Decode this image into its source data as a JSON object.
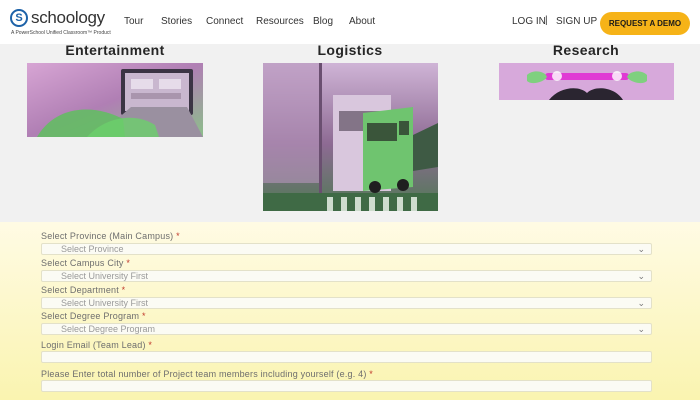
{
  "header": {
    "logo_text": "schoology",
    "logo_letter": "S",
    "logo_tagline": "A PowerSchool Unified Classroom™ Product",
    "nav": [
      "Tour",
      "Stories",
      "Connect",
      "Resources",
      "Blog",
      "About"
    ],
    "login": "LOG IN",
    "separator": "|",
    "signup": "SIGN UP",
    "demo_button": "REQUEST A DEMO"
  },
  "categories": [
    {
      "title": "Entertainment"
    },
    {
      "title": "Logistics"
    },
    {
      "title": "Research"
    }
  ],
  "form": {
    "fields": [
      {
        "label": "Select Province (Main Campus)",
        "required": "*",
        "value": "Select Province",
        "icon": "chevron-down-icon"
      },
      {
        "label": "Select Campus City",
        "required": "*",
        "value": "Select University First",
        "icon": "chevron-down-icon"
      },
      {
        "label": "Select Department",
        "required": "*",
        "value": "Select University First",
        "icon": "chevron-down-icon"
      },
      {
        "label": "Select Degree Program",
        "required": "*",
        "value": "Select Degree Program",
        "icon": "chevron-down-icon"
      },
      {
        "label": "Login Email (Team Lead)",
        "required": "*",
        "value": ""
      },
      {
        "label": "Please Enter total number of Project team members including yourself (e.g. 4)",
        "required": "*",
        "value": ""
      }
    ]
  },
  "colors": {
    "brand_blue": "#1d62a8",
    "demo_button": "#f6b318",
    "required_star": "#c0392b"
  }
}
